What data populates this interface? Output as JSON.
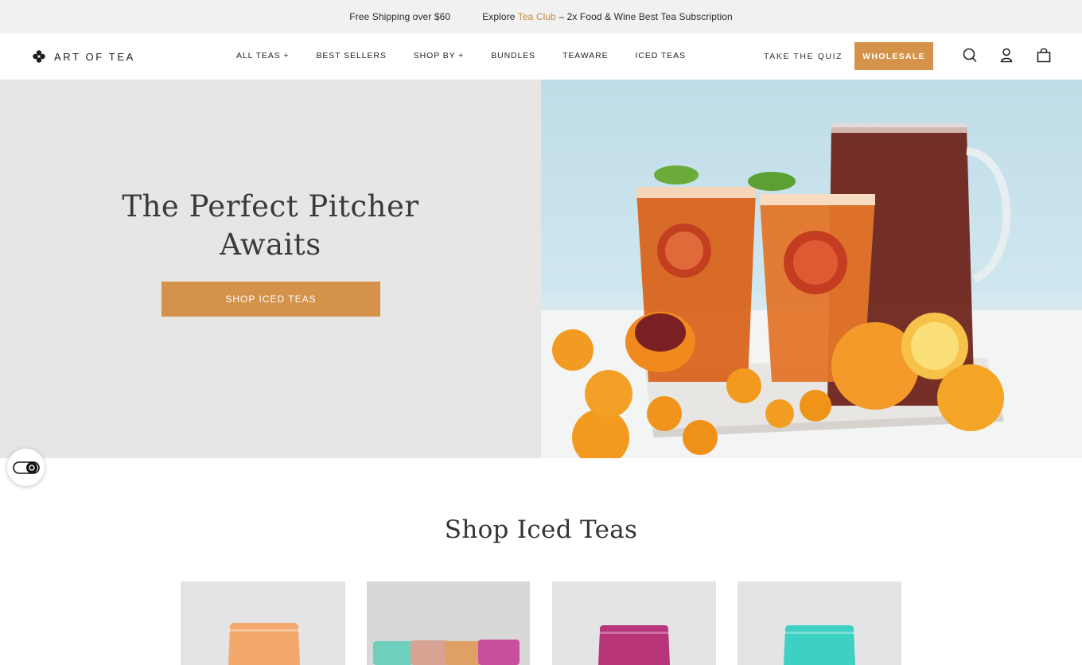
{
  "announcement": {
    "shipping": "Free Shipping over $60",
    "explore_prefix": "Explore ",
    "explore_link": "Tea Club",
    "explore_suffix": " – 2x Food & Wine Best Tea Subscription"
  },
  "header": {
    "logo_text": "ART OF TEA",
    "nav": [
      {
        "label": "ALL TEAS +"
      },
      {
        "label": "BEST SELLERS"
      },
      {
        "label": "SHOP BY +"
      },
      {
        "label": "BUNDLES"
      },
      {
        "label": "TEAWARE"
      },
      {
        "label": "ICED TEAS"
      }
    ],
    "quiz_label": "TAKE THE QUIZ",
    "wholesale_label": "WHOLESALE",
    "icons": [
      "search-icon",
      "account-icon",
      "cart-icon"
    ]
  },
  "hero": {
    "title_line1": "The Perfect Pitcher",
    "title_line2": "Awaits",
    "cta_label": "SHOP ICED TEAS"
  },
  "section": {
    "title": "Shop Iced Teas"
  },
  "products": [
    {
      "pouch_colors": [
        "#f2a96b"
      ]
    },
    {
      "pouch_colors": [
        "#6fcfbd",
        "#d9a394",
        "#e0a064",
        "#c94e9c"
      ]
    },
    {
      "pouch_colors": [
        "#b8357a"
      ]
    },
    {
      "pouch_colors": [
        "#3fd0c4"
      ]
    }
  ],
  "colors": {
    "accent": "#d4924a",
    "hero_bg": "#e7e6e4"
  }
}
